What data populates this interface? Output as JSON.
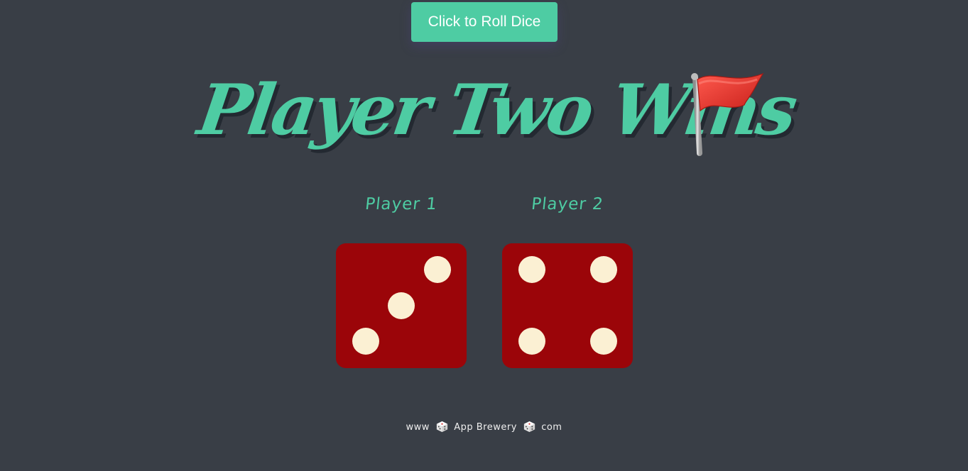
{
  "header": {
    "roll_button_label": "Click to Roll Dice"
  },
  "title": {
    "text": "Player Two Wins",
    "icon": "red-flag-icon"
  },
  "players": [
    {
      "label": "Player 1",
      "die_value": 3
    },
    {
      "label": "Player 2",
      "die_value": 4
    }
  ],
  "footer": {
    "prefix": "www",
    "site_name": "App Brewery",
    "suffix": "com",
    "separator_icon": "dice-icon"
  },
  "colors": {
    "background": "#393E46",
    "accent": "#4ECCA3",
    "die_face": "#9B0509",
    "die_pip": "#FBF0D3",
    "flag": "#E0322B"
  }
}
